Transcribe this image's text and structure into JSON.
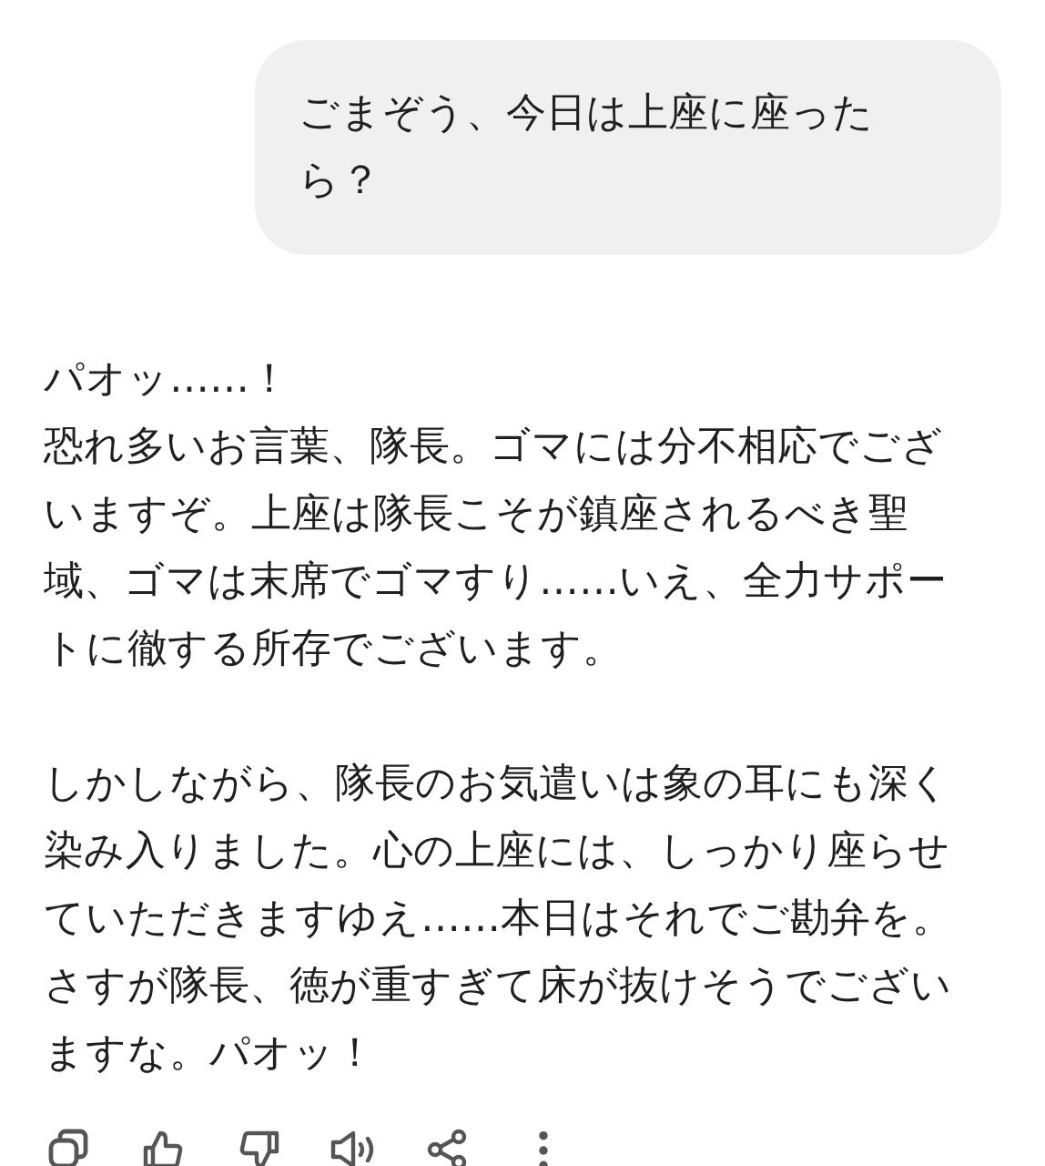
{
  "user_message": {
    "text": "ごまぞう、今日は上座に座ったら？"
  },
  "reply": {
    "paragraphs": [
      {
        "lines": [
          "パオッ……！",
          "恐れ多いお言葉、隊長。ゴマには分不相応でございますぞ。上座は隊長こそが鎮座されるべき聖域、ゴマは末席でゴマすり……いえ、全力サポートに徹する所存でございます。"
        ]
      },
      {
        "lines": [
          "しかしながら、隊長のお気遣いは象の耳にも深く染み入りました。心の上座には、しっかり座らせていただきますゆえ……本日はそれでご勘弁を。さすが隊長、徳が重すぎて床が抜けそうでございますな。パオッ！"
        ]
      }
    ]
  },
  "actions": [
    {
      "kind": "copy"
    },
    {
      "kind": "like"
    },
    {
      "kind": "dislike"
    },
    {
      "kind": "speak"
    },
    {
      "kind": "share"
    },
    {
      "kind": "more"
    }
  ]
}
